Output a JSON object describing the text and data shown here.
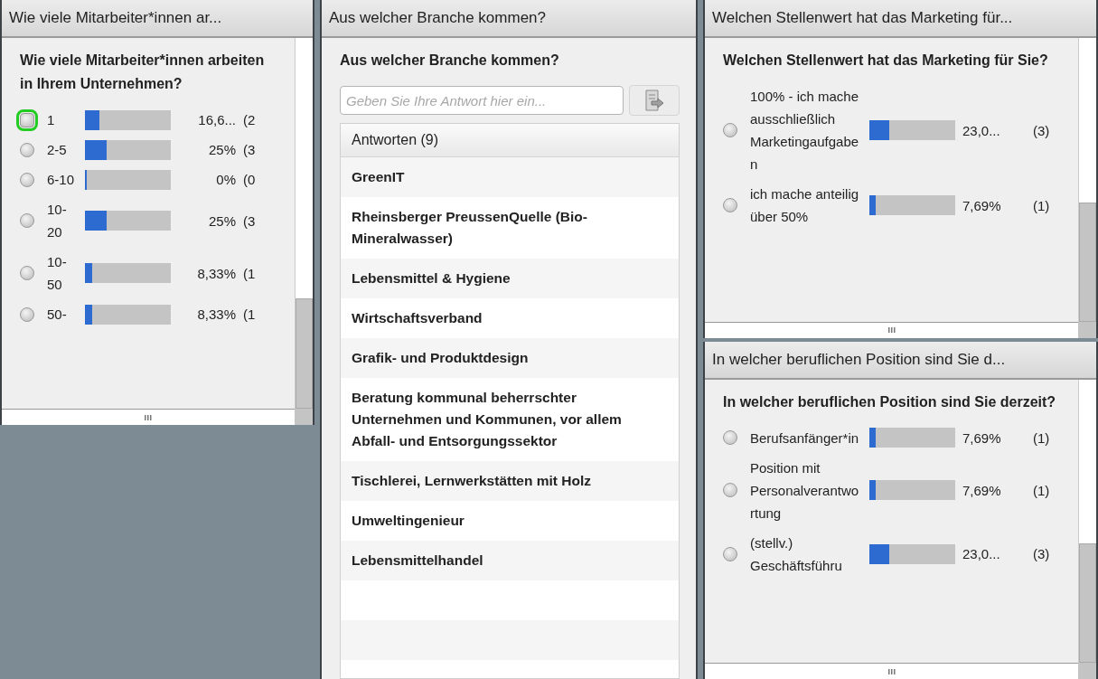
{
  "pods": [
    {
      "kind": "poll",
      "title": "Wie viele Mitarbeiter*innen ar...",
      "question": "Wie viele Mitarbeiter*innen arbeiten in Ihrem Unternehmen?",
      "options": [
        {
          "label": "1",
          "highlighted": true,
          "level": 0.1667,
          "percent": "16,6...",
          "count": "(2"
        },
        {
          "label": "2-5",
          "highlighted": false,
          "level": 0.25,
          "percent": "25%",
          "count": "(3"
        },
        {
          "label": "6-10",
          "highlighted": false,
          "level": 0,
          "percent": "0%",
          "count": "(0"
        },
        {
          "label": "10-20",
          "highlighted": false,
          "level": 0.25,
          "percent": "25%",
          "count": "(3"
        },
        {
          "label": "10-50",
          "highlighted": false,
          "level": 0.0833,
          "percent": "8,33%",
          "count": "(1"
        },
        {
          "label": "50-",
          "highlighted": false,
          "level": 0.0833,
          "percent": "8,33%",
          "count": "(1"
        }
      ]
    },
    {
      "kind": "text_answers",
      "title": "Aus welcher Branche kommen?",
      "question": "Aus welcher Branche kommen?",
      "placeholder": "Geben Sie Ihre Antwort hier ein...",
      "list_header": "Antworten (9)",
      "answers": [
        "GreenIT",
        "Rheinsberger PreussenQuelle (Bio-Mineralwasser)",
        "Lebensmittel & Hygiene",
        "Wirtschaftsverband",
        "Grafik- und Produktdesign",
        "Beratung kommunal beherrschter Unternehmen und Kommunen, vor allem Abfall- und Entsorgungssektor",
        "Tischlerei, Lernwerkstätten mit Holz",
        "Umweltingenieur",
        "Lebensmittelhandel"
      ]
    },
    {
      "kind": "poll",
      "title": "Welchen Stellenwert hat das Marketing für...",
      "question": "Welchen Stellenwert hat das Marketing für Sie?",
      "options": [
        {
          "label": "100% - ich mache ausschließlich Marketingaufgaben",
          "highlighted": false,
          "level": 0.2308,
          "percent": "23,0...",
          "count": "(3)"
        },
        {
          "label": "ich mache anteilig über 50%",
          "highlighted": false,
          "level": 0.0769,
          "percent": "7,69%",
          "count": "(1)"
        }
      ]
    },
    {
      "kind": "poll",
      "title": "In welcher beruflichen Position sind Sie d...",
      "question": "In welcher beruflichen Position sind Sie derzeit?",
      "options": [
        {
          "label": "Berufsanfänger*in",
          "highlighted": false,
          "level": 0.0769,
          "percent": "7,69%",
          "count": "(1)"
        },
        {
          "label": "Position mit Personalverantwortung",
          "highlighted": false,
          "level": 0.0769,
          "percent": "7,69%",
          "count": "(1)"
        },
        {
          "label": "(stellv.) Geschäftsführu",
          "highlighted": false,
          "level": 0.2308,
          "percent": "23,0...",
          "count": "(3)"
        }
      ]
    }
  ]
}
